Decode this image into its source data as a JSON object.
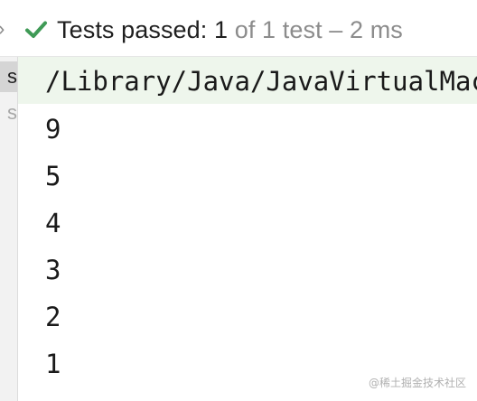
{
  "status": {
    "main": "Tests passed: 1",
    "sub": " of 1 test – 2 ms",
    "check_color": "#3f9a56"
  },
  "left_pane": {
    "items": [
      {
        "label": "s",
        "selected": true
      },
      {
        "label": "s",
        "selected": false
      }
    ]
  },
  "console": {
    "command": "/Library/Java/JavaVirtualMachines",
    "lines": [
      "9",
      "5",
      "4",
      "3",
      "2",
      "1"
    ]
  },
  "watermark": "@稀土掘金技术社区"
}
